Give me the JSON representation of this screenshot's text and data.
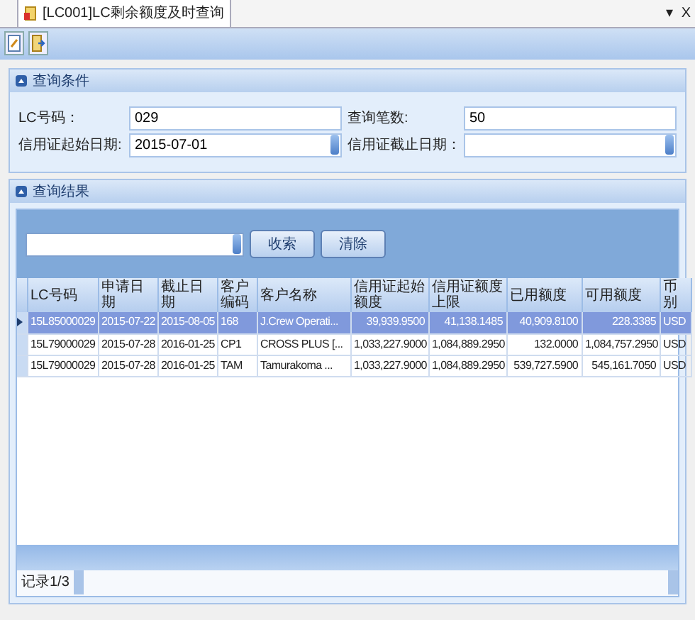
{
  "tab": {
    "title": "[LC001]LC剩余额度及时查询",
    "selected": true
  },
  "window_controls": [
    "▾",
    "X"
  ],
  "query_panel": {
    "title": "查询条件",
    "fields": [
      {
        "label": "LC号码：",
        "value": "029",
        "kind": "text"
      },
      {
        "label": "查询笔数:",
        "value": "50",
        "kind": "text"
      },
      {
        "label": "信用证起始日期:",
        "value": "2015-07-01",
        "kind": "date"
      },
      {
        "label": "信用证截止日期：",
        "kind": "date"
      }
    ]
  },
  "results_panel": {
    "title": "查询结果",
    "buttons": [
      "收索",
      "清除"
    ],
    "columns": [
      {
        "label": "LC号码",
        "kind": "text"
      },
      {
        "label": "申请日期",
        "kind": "text"
      },
      {
        "label": "截止日期",
        "kind": "text"
      },
      {
        "label": "客户编码",
        "kind": "text"
      },
      {
        "label": "客户名称",
        "kind": "text"
      },
      {
        "label": "信用证起始额度",
        "kind": "number"
      },
      {
        "label": "信用证额度上限",
        "kind": "number"
      },
      {
        "label": "已用额度",
        "kind": "number"
      },
      {
        "label": "可用额度",
        "kind": "number"
      },
      {
        "label": "币别",
        "kind": "text"
      }
    ],
    "rows": [
      {
        "selected": true,
        "cells": [
          "15L85000029",
          "2015-07-22",
          "2015-08-05",
          "168",
          "J.Crew Operati...",
          "39,939.9500",
          "41,138.1485",
          "40,909.8100",
          "228.3385",
          "USD"
        ]
      },
      {
        "selected": false,
        "cells": [
          "15L79000029",
          "2015-07-28",
          "2016-01-25",
          "CP1",
          "CROSS PLUS [...",
          "1,033,227.9000",
          "1,084,889.2950",
          "132.0000",
          "1,084,757.2950",
          "USD"
        ]
      },
      {
        "selected": false,
        "cells": [
          "15L79000029",
          "2015-07-28",
          "2016-01-25",
          "TAM",
          "Tamurakoma ...",
          "1,033,227.9000",
          "1,084,889.2950",
          "539,727.5900",
          "545,161.7050",
          "USD"
        ]
      }
    ],
    "record": "记录1/3"
  }
}
